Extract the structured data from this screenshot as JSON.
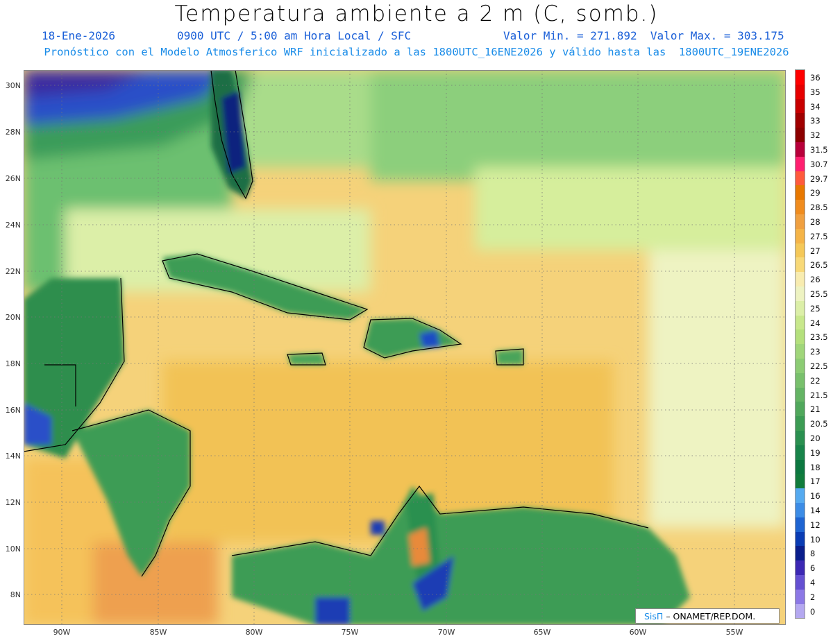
{
  "header": {
    "title": "Temperatura ambiente a 2 m (C, somb.)",
    "date": "18-Ene-2026",
    "time": "0900 UTC / 5:00 am Hora Local / SFC",
    "minmax": "Valor Min. = 271.892  Valor Max. = 303.175",
    "subtitle": "Pronóstico con el Modelo Atmosferico WRF inicializado a las 1800UTC_16ENE2026 y válido hasta las  1800UTC_19ENE2026"
  },
  "axes": {
    "lat_labels": [
      "30N",
      "28N",
      "26N",
      "24N",
      "22N",
      "20N",
      "18N",
      "16N",
      "14N",
      "12N",
      "10N",
      "8N"
    ],
    "lon_labels": [
      "90W",
      "85W",
      "80W",
      "75W",
      "70W",
      "65W",
      "60W",
      "55W"
    ]
  },
  "legend": {
    "labels": [
      "36",
      "35",
      "34",
      "33",
      "32",
      "31.5",
      "30.7",
      "29.7",
      "29",
      "28.5",
      "28",
      "27.5",
      "27",
      "26.5",
      "26",
      "25.5",
      "25",
      "24",
      "23.5",
      "23",
      "22.5",
      "22",
      "21.5",
      "21",
      "20.5",
      "20",
      "19",
      "18",
      "17",
      "16",
      "14",
      "12",
      "10",
      "8",
      "6",
      "4",
      "2",
      "0"
    ],
    "colors": [
      "#ff0000",
      "#e60000",
      "#c80000",
      "#a00000",
      "#8c0000",
      "#b8003a",
      "#ff1f6f",
      "#ff5a3c",
      "#e87800",
      "#f08c1e",
      "#f0a040",
      "#f5b447",
      "#f5c858",
      "#f8d978",
      "#f8ecb0",
      "#eef3c2",
      "#dcefa8",
      "#c8e88c",
      "#b4e07c",
      "#a0d67a",
      "#8ccc74",
      "#78c06c",
      "#64b464",
      "#50a85c",
      "#3c9c54",
      "#2a9050",
      "#18844a",
      "#0c7840",
      "#107c3c",
      "#55aaf0",
      "#3c8ce6",
      "#1e64d2",
      "#0a3cb4",
      "#0a1e8c",
      "#3c28b4",
      "#6450d2",
      "#8c78e6",
      "#b4a8f0"
    ]
  },
  "credit": {
    "brand": "SisΠ",
    "org": "– ONAMET/REP.DOM."
  }
}
